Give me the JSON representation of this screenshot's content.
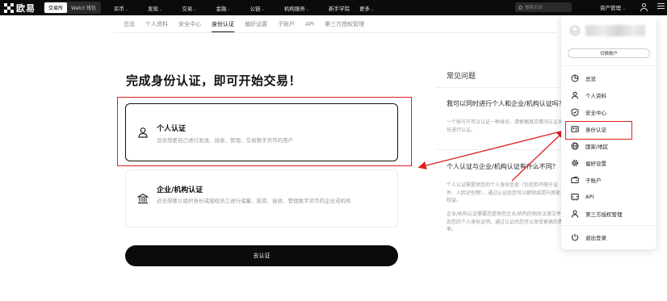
{
  "nav": {
    "logo_text": "欧易",
    "mode_tabs": [
      "交易所",
      "Web3 钱包"
    ],
    "menu": [
      "买币",
      "发现",
      "交易",
      "金融",
      "公链",
      "机构服务",
      "新手学院",
      "更多"
    ],
    "search_placeholder": "搜索币对",
    "asset_label": "资产管理"
  },
  "subtabs": [
    "总览",
    "个人资料",
    "安全中心",
    "身份认证",
    "偏好设置",
    "子账户",
    "API",
    "第三方授权管理"
  ],
  "main": {
    "title": "完成身份认证，即可开始交易！",
    "personal": {
      "title": "个人认证",
      "desc": "适合想要自己进行发送、接收、管理、交易数字货币的用户"
    },
    "corporate": {
      "title": "企业/机构认证",
      "desc": "适合想要以组织身份或授权员工进行储蓄、投资、接收、管理数字货币的企业或机构"
    },
    "go_button": "去认证"
  },
  "faq": {
    "title": "常见问题",
    "q1": "我可以同时进行个人和企业/机构认证吗？",
    "a1": "一个账号只可以认证一种身份，请根据真实情况认证身份进行认证。",
    "q2": "个人认证与企业/机构认证有什么不同？",
    "a2_1": "个人认证需提供您的个人身份信息（包括但不限于证件、人脸识别等），通过认证后您可以解锁或提升其他权益。",
    "a2_2": "企业/机构认证需要您提供您企业/机构的相关法律文件及您的个人身份证明，通过认证后您可以享受更高的费率。"
  },
  "dropdown": {
    "switch_account": "切换账户",
    "items": [
      "总览",
      "个人资料",
      "安全中心",
      "身份认证",
      "国家/地区",
      "偏好设置",
      "子账户",
      "API",
      "第三方授权管理"
    ],
    "logout": "退出登录"
  }
}
